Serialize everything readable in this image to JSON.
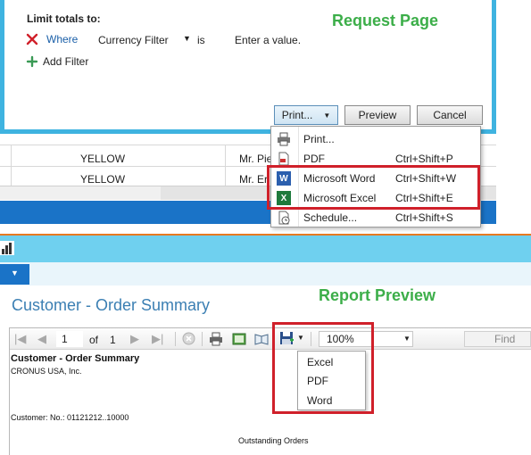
{
  "request_page": {
    "section_label": "Limit totals to:",
    "filter_row": {
      "remove_icon": "x-icon",
      "where_label": "Where",
      "field_label": "Currency Filter",
      "is_label": "is",
      "value_placeholder": "Enter a value."
    },
    "add_filter_label": "Add Filter",
    "callout": "Request Page",
    "buttons": {
      "print": "Print...",
      "preview": "Preview",
      "cancel": "Cancel"
    }
  },
  "background_grid": {
    "rows": [
      {
        "color": "YELLOW",
        "name": "Mr. Pie"
      },
      {
        "color": "YELLOW",
        "name": "Mr. Er"
      }
    ]
  },
  "print_menu": {
    "items": [
      {
        "label": "Print...",
        "shortcut": "",
        "icon": "printer-icon"
      },
      {
        "label": "PDF",
        "shortcut": "Ctrl+Shift+P",
        "icon": "pdf-icon"
      },
      {
        "label": "Microsoft Word",
        "shortcut": "Ctrl+Shift+W",
        "icon": "word-icon"
      },
      {
        "label": "Microsoft Excel",
        "shortcut": "Ctrl+Shift+E",
        "icon": "excel-icon"
      },
      {
        "label": "Schedule...",
        "shortcut": "Ctrl+Shift+S",
        "icon": "schedule-icon"
      }
    ]
  },
  "report_preview": {
    "callout": "Report Preview",
    "title": "Customer - Order Summary",
    "toolbar": {
      "page_current": "1",
      "of_label": "of",
      "page_total": "1",
      "zoom": "100%",
      "find_label": "Find"
    },
    "export_menu": [
      "Excel",
      "PDF",
      "Word"
    ],
    "report_body": {
      "heading": "Customer - Order Summary",
      "company": "CRONUS USA, Inc.",
      "filter_line": "Customer: No.: 01121212..10000",
      "section": "Outstanding Orders"
    }
  },
  "colors": {
    "dialog_border": "#3fb3e0",
    "callout_green": "#3cae49",
    "highlight_red": "#d0202a",
    "blue_bar": "#1a73c7",
    "title_blue": "#3b7fb3",
    "divider_orange": "#e67a22"
  }
}
